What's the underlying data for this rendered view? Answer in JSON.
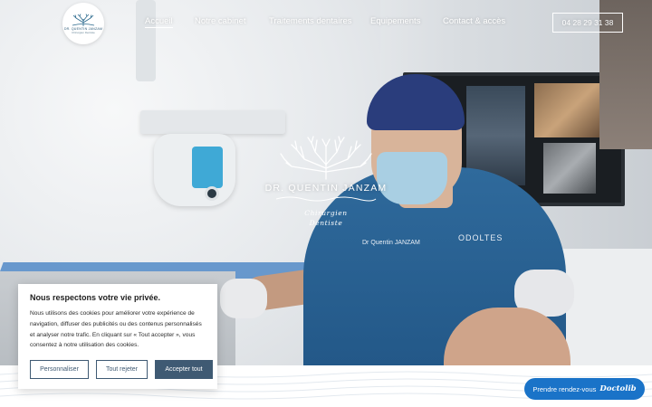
{
  "logo": {
    "name": "DR. QUENTIN JANZAM",
    "subtitle": "Chirurgien Dentiste"
  },
  "nav": {
    "items": [
      {
        "label": "Accueil",
        "active": true
      },
      {
        "label": "Notre cabinet",
        "active": false
      },
      {
        "label": "Traitements dentaires",
        "active": false
      },
      {
        "label": "Equipements",
        "active": false
      },
      {
        "label": "Contact & accès",
        "active": false
      }
    ],
    "phone": "04 28 29 31 38"
  },
  "hero": {
    "name": "DR. QUENTIN JANZAM",
    "role_line1": "Chirurgien",
    "role_line2": "Dentiste",
    "shirt_name": "Dr Quentin JANZAM",
    "shirt_brand": "ODOLTES"
  },
  "cookie": {
    "title": "Nous respectons votre vie privée.",
    "text": "Nous utilisons des cookies pour améliorer votre expérience de navigation, diffuser des publicités ou des contenus personnalisés et analyser notre trafic. En cliquant sur « Tout accepter », vous consentez à notre utilisation des cookies.",
    "customize": "Personnaliser",
    "reject": "Tout rejeter",
    "accept": "Accepter tout"
  },
  "doctolib": {
    "label": "Prendre rendez-vous",
    "brand": "Doctolib"
  },
  "colors": {
    "accent": "#3f5a73",
    "doctolib": "#1a73c8",
    "scrub": "#2f6a9c"
  }
}
